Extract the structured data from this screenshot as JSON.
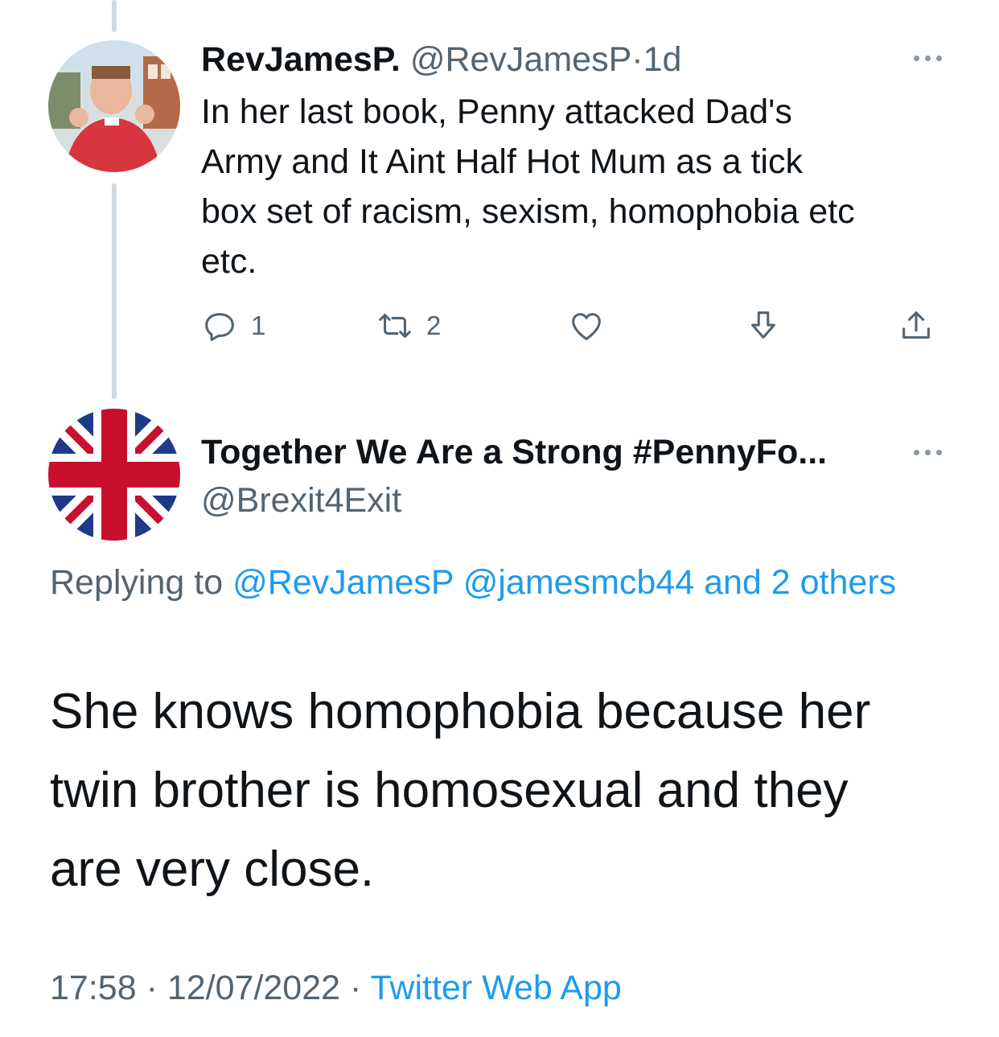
{
  "parent_tweet": {
    "display_name": "RevJamesP.",
    "handle": "@RevJamesP",
    "separator": "·",
    "age": "1d",
    "text_lines": [
      "In her last book, Penny attacked Dad's",
      "Army and It Aint Half Hot Mum as a tick",
      "box set of racism, sexism, homophobia etc",
      "etc."
    ],
    "actions": {
      "reply_count": "1",
      "retweet_count": "2"
    }
  },
  "main_tweet": {
    "display_name": "Together We Are a Strong #PennyFo...",
    "handle": "@Brexit4Exit",
    "replying": {
      "prefix": "Replying to",
      "targets": [
        "@RevJamesP",
        "@jamesmcb44",
        "and 2 others"
      ]
    },
    "text_lines": [
      "She knows homophobia because her",
      "twin brother is homosexual and they",
      "are very close."
    ],
    "time": "17:58",
    "date": "12/07/2022",
    "separator": "·",
    "source": "Twitter Web App"
  },
  "colors": {
    "text_primary": "#0f1419",
    "text_secondary": "#536471",
    "link": "#1d9bf0",
    "thread_line": "#cfd9de"
  },
  "icons": [
    "reply-icon",
    "retweet-icon",
    "like-icon",
    "download-icon",
    "share-icon",
    "more-icon"
  ]
}
